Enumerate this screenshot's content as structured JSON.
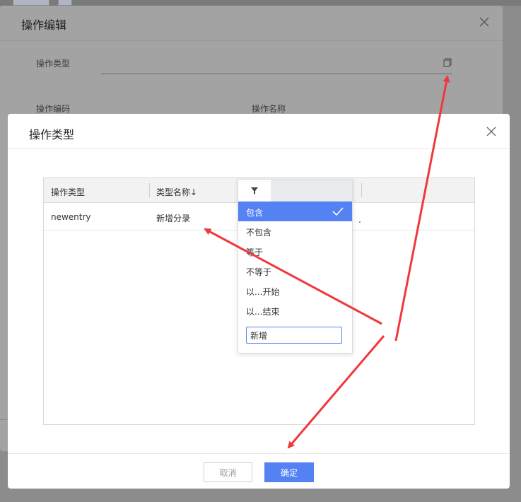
{
  "background": {
    "dialog_title": "操作编辑",
    "fields": [
      {
        "label": "操作类型"
      },
      {
        "label": "操作编码"
      },
      {
        "label": "操作名称"
      }
    ]
  },
  "modal": {
    "title": "操作类型",
    "columns": [
      "操作类型",
      "类型名称↓"
    ],
    "rows": [
      {
        "type": "newentry",
        "name": "新增分录"
      }
    ],
    "cut_off_text": "."
  },
  "filter_popup": {
    "options": [
      {
        "label": "包含",
        "selected": true
      },
      {
        "label": "不包含",
        "selected": false
      },
      {
        "label": "等于",
        "selected": false
      },
      {
        "label": "不等于",
        "selected": false
      },
      {
        "label": "以...开始",
        "selected": false
      },
      {
        "label": "以...结束",
        "selected": false
      }
    ],
    "input_value": "新增"
  },
  "footer": {
    "cancel_label": "取消",
    "ok_label": "确定"
  },
  "colors": {
    "accent": "#5582f3",
    "annotation_arrow": "#f0383c"
  },
  "icons": [
    "close-icon",
    "copy-icon",
    "filter-icon",
    "check-icon"
  ]
}
